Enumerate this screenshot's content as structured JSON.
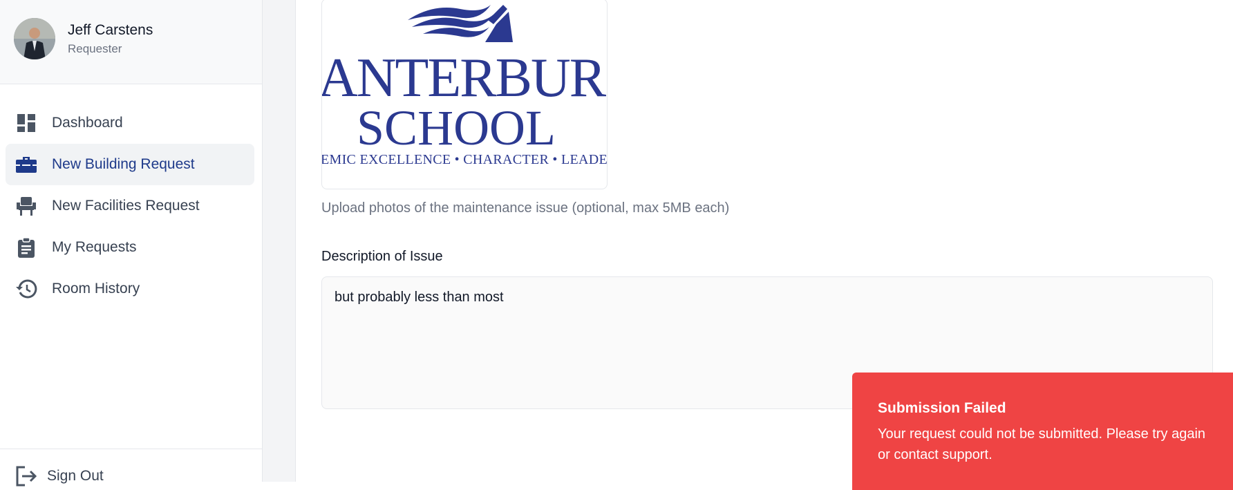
{
  "user": {
    "name": "Jeff Carstens",
    "role": "Requester"
  },
  "nav": {
    "items": [
      {
        "label": "Dashboard",
        "icon": "dashboard-icon"
      },
      {
        "label": "New Building Request",
        "icon": "toolbox-icon",
        "active": true
      },
      {
        "label": "New Facilities Request",
        "icon": "chair-icon"
      },
      {
        "label": "My Requests",
        "icon": "clipboard-icon"
      },
      {
        "label": "Room History",
        "icon": "history-icon"
      }
    ],
    "signout_label": "Sign Out"
  },
  "form": {
    "logo": {
      "line1": "ANTERBUR",
      "line2": "SCHOOL",
      "line3": "EMIC EXCELLENCE • CHARACTER • LEADERSHIP • SE"
    },
    "photo_hint": "Upload photos of the maintenance issue (optional, max 5MB each)",
    "description_label": "Description of Issue",
    "description_value": "but probably less than most"
  },
  "toast": {
    "title": "Submission Failed",
    "message": "Your request could not be submitted. Please try again or contact support."
  },
  "colors": {
    "accent": "#1e3a8a",
    "error": "#ef4444",
    "logo_blue": "#2b3990"
  }
}
